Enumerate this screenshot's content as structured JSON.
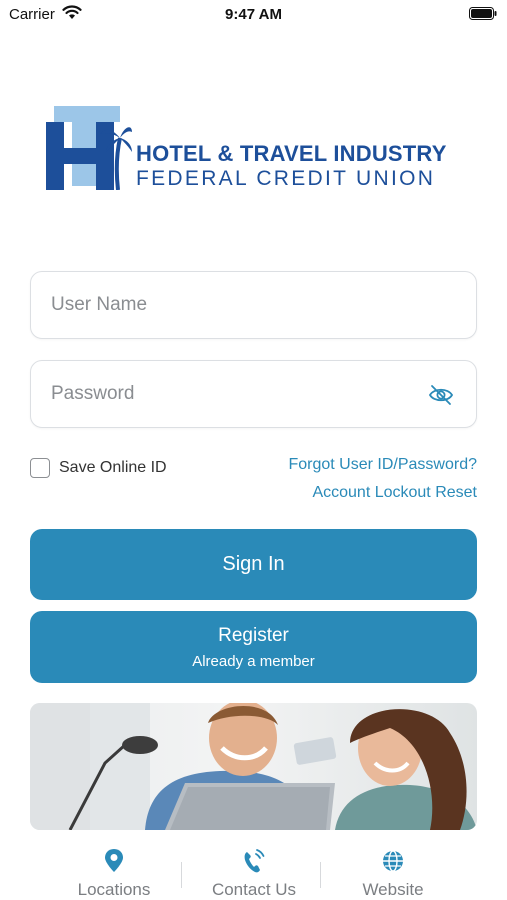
{
  "status_bar": {
    "carrier": "Carrier",
    "time": "9:47 AM"
  },
  "logo": {
    "line1": "HOTEL & TRAVEL INDUSTRY",
    "line2": "FEDERAL CREDIT UNION",
    "mark_letters": "HT"
  },
  "login": {
    "username_placeholder": "User Name",
    "password_placeholder": "Password",
    "save_id_label": "Save Online ID",
    "save_id_checked": false,
    "forgot_link": "Forgot User ID/Password?",
    "lockout_link": "Account Lockout Reset"
  },
  "buttons": {
    "sign_in": "Sign In",
    "register": "Register",
    "register_sub": "Already a member"
  },
  "tabbar": {
    "items": [
      {
        "label": "Locations",
        "icon": "location-pin-icon"
      },
      {
        "label": "Contact Us",
        "icon": "phone-icon"
      },
      {
        "label": "Website",
        "icon": "globe-icon"
      }
    ]
  },
  "colors": {
    "accent": "#2a8ab8",
    "logo_blue": "#1d4f9a",
    "logo_light_blue": "#9cc6e8"
  }
}
